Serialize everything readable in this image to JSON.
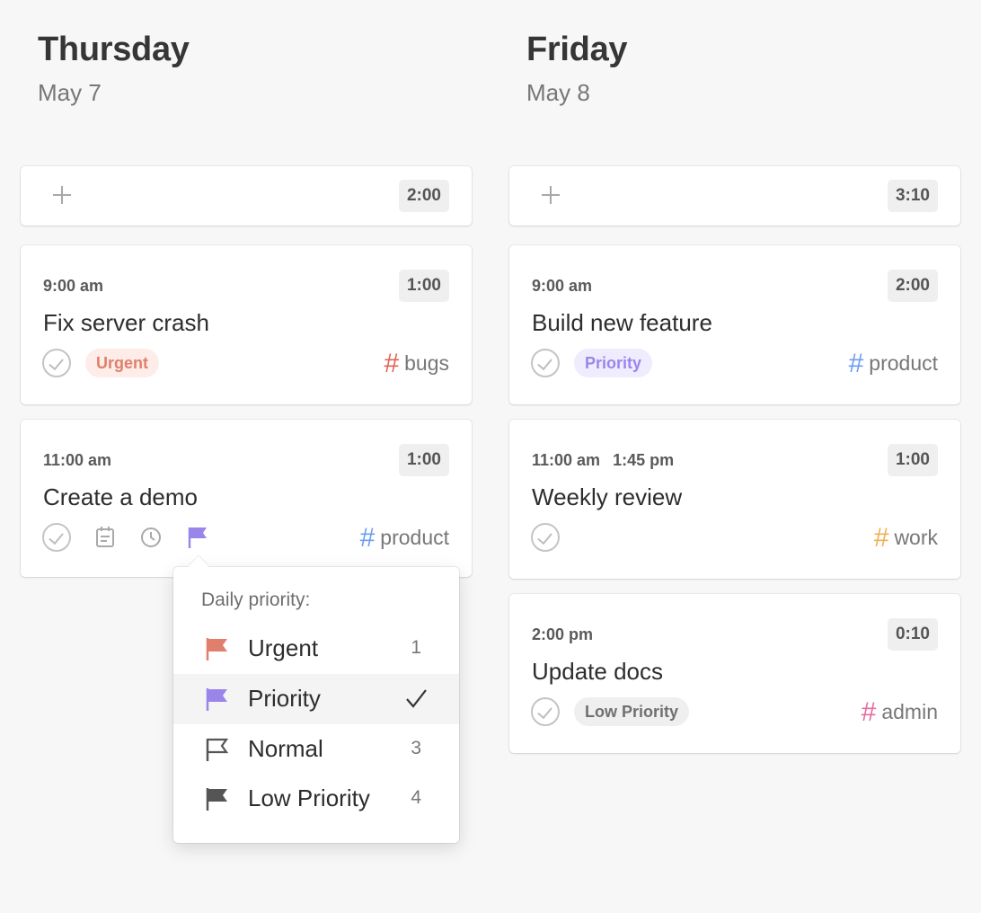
{
  "days": [
    {
      "name": "Thursday",
      "date": "May 7",
      "total": "2:00",
      "tasks": [
        {
          "time": "9:00 am",
          "duration": "1:00",
          "title": "Fix server crash",
          "badge": "Urgent",
          "tag": "bugs",
          "tag_color": "#e0655a"
        },
        {
          "time": "11:00 am",
          "duration": "1:00",
          "title": "Create a demo",
          "tag": "product",
          "tag_color": "#6c9ef0"
        }
      ]
    },
    {
      "name": "Friday",
      "date": "May 8",
      "total": "3:10",
      "tasks": [
        {
          "time": "9:00 am",
          "duration": "2:00",
          "title": "Build new feature",
          "badge": "Priority",
          "tag": "product",
          "tag_color": "#6c9ef0"
        },
        {
          "time": "11:00 am",
          "end_time": "1:45 pm",
          "duration": "1:00",
          "title": "Weekly review",
          "tag": "work",
          "tag_color": "#f0b055"
        },
        {
          "time": "2:00 pm",
          "duration": "0:10",
          "title": "Update docs",
          "badge": "Low Priority",
          "tag": "admin",
          "tag_color": "#e86aa0"
        }
      ]
    }
  ],
  "priority_menu": {
    "title": "Daily priority:",
    "items": [
      {
        "label": "Urgent",
        "shortcut": "1",
        "flag_color": "#e0806c"
      },
      {
        "label": "Priority",
        "selected": true,
        "flag_color": "#9a86ea"
      },
      {
        "label": "Normal",
        "shortcut": "3",
        "flag_color": "#555555"
      },
      {
        "label": "Low Priority",
        "shortcut": "4",
        "flag_color": "#555555"
      }
    ]
  },
  "hash_symbol": "#",
  "icons": [
    "plus-icon",
    "check-circle-icon",
    "calendar-icon",
    "clock-icon",
    "flag-icon",
    "checkmark-icon"
  ]
}
